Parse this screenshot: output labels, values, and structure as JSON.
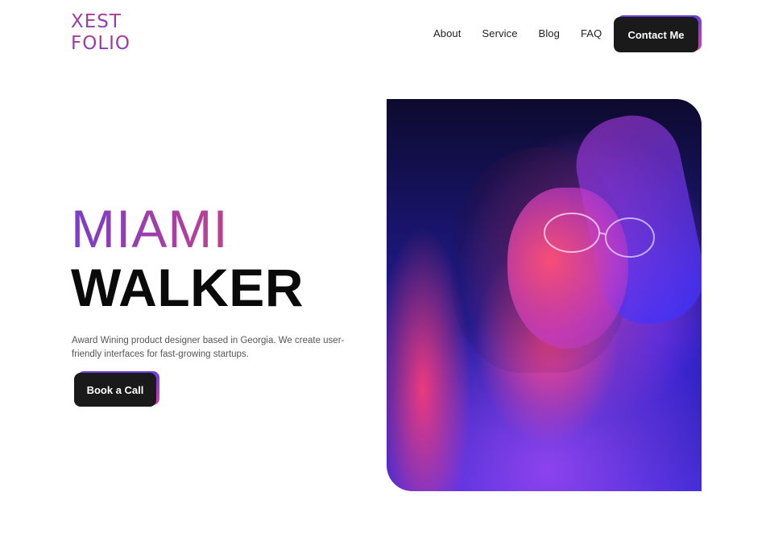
{
  "logo": {
    "line1": "XEST",
    "line2": "FOLIO"
  },
  "nav": {
    "items": [
      "About",
      "Service",
      "Blog",
      "FAQ"
    ],
    "contact_label": "Contact Me"
  },
  "hero": {
    "first_name": "MIAMI",
    "last_name": "WALKER",
    "description": "Award Wining product designer based in Georgia. We create user-friendly interfaces for fast-growing startups.",
    "cta_label": "Book a Call"
  },
  "colors": {
    "accent_purple": "#7a3ec8",
    "accent_pink": "#c0408f",
    "button_dark": "#1a1a1a"
  },
  "photo": {
    "icon": "portrait-photo"
  }
}
